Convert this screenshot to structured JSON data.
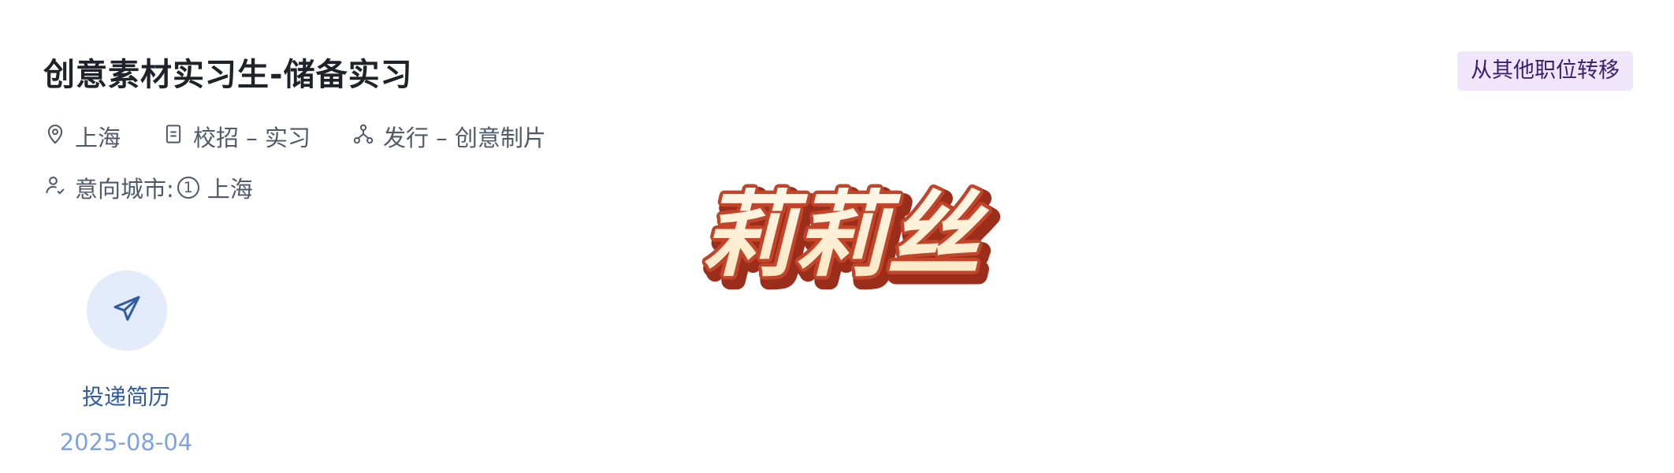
{
  "job": {
    "title": "创意素材实习生-储备实习",
    "transfer_badge": "从其他职位转移",
    "location": "上海",
    "recruit_type": "校招 – 实习",
    "department": "发行 – 创意制片",
    "intent_label": "意向城市:",
    "intent_rank": "1",
    "intent_city": "上海"
  },
  "apply": {
    "label": "投递简历",
    "date": "2025-08-04"
  },
  "watermark": {
    "text": "莉莉丝"
  },
  "icons": {
    "location": "location-pin-icon",
    "recruit": "document-icon",
    "department": "org-chart-icon",
    "intent": "user-check-icon",
    "apply": "paper-plane-icon"
  },
  "colors": {
    "badge_bg": "#efe6fc",
    "apply_circle_bg": "#e4ecfb",
    "apply_label": "#2f5aa6",
    "apply_date": "#7da4de",
    "watermark_fill": "#fdf1d8",
    "watermark_stroke": "#c2452a"
  }
}
